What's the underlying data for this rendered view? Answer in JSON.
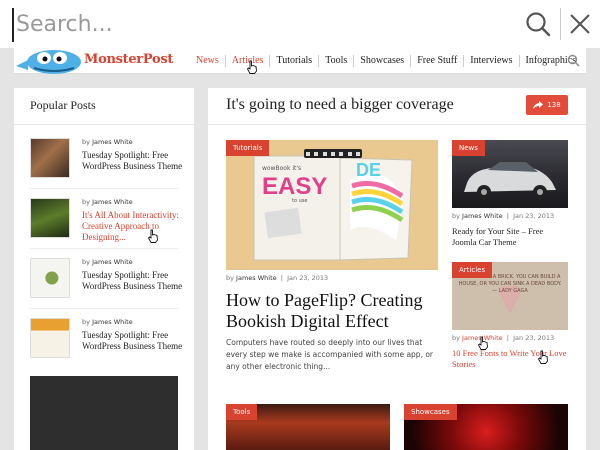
{
  "search": {
    "placeholder": "Search..."
  },
  "header": {
    "logo_text": "MonsterPost",
    "nav": [
      "News",
      "Articles",
      "Tutorials",
      "Tools",
      "Showcases",
      "Free Stuff",
      "Interviews",
      "Infographics"
    ]
  },
  "sidebar": {
    "title": "Popular Posts",
    "posts": [
      {
        "by": "by",
        "author": "James White",
        "title": "Tuesday Spotlight: Free WordPress Business Theme"
      },
      {
        "by": "by",
        "author": "James White",
        "title": "It's All About Interactivity: Creative Approach to Designing..."
      },
      {
        "by": "by",
        "author": "James White",
        "title": "Tuesday Spotlight: Free WordPress Business Theme"
      },
      {
        "by": "by",
        "author": "James White",
        "title": "Tuesday Spotlight: Free WordPress Business Theme"
      }
    ]
  },
  "main": {
    "title": "It's going to need a bigger coverage",
    "share_count": "138",
    "feature": {
      "tag": "Tutorials",
      "image_text": [
        "wowBook it's",
        "EASY",
        "to use",
        "DE"
      ],
      "author": "James White",
      "date": "Jan 23, 2013",
      "title": "How to PageFlip? Creating Bookish Digital Effect",
      "excerpt": "Computers have routed so deeply into our lives that every step we make is accompanied with some app, or any other electronic thing..."
    },
    "side_cards": [
      {
        "tag": "News",
        "author": "James White",
        "date": "Jan 23, 2013",
        "title": "Ready for Your Site – Free Joomla Car Theme"
      },
      {
        "tag": "Articles",
        "author": "James White",
        "date": "Jan 23, 2013",
        "title": "10 Free Fonts to Write Your Love Stories",
        "image_text": "LOVE IS LIKE A BRICK. YOU CAN BUILD A HOUSE, OR YOU CAN SINK A DEAD BODY. — LADY GAGA"
      }
    ],
    "bottom_tags": [
      "Tools",
      "Showcases"
    ]
  },
  "colors": {
    "accent": "#d8422e",
    "share": "#e24d3b"
  }
}
